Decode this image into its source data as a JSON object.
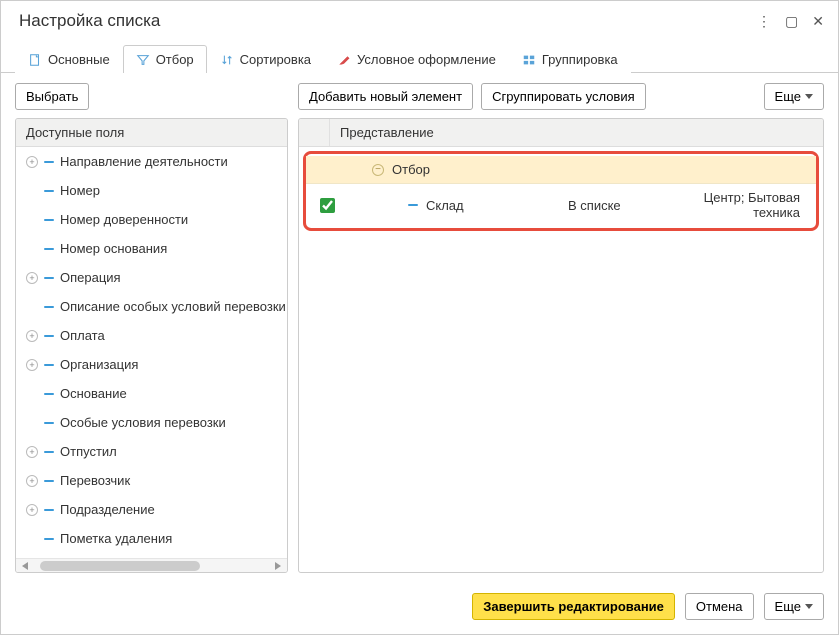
{
  "window": {
    "title": "Настройка списка"
  },
  "tabs": [
    {
      "label": "Основные"
    },
    {
      "label": "Отбор"
    },
    {
      "label": "Сортировка"
    },
    {
      "label": "Условное оформление"
    },
    {
      "label": "Группировка"
    }
  ],
  "toolbar": {
    "select_label": "Выбрать",
    "add_label": "Добавить новый элемент",
    "group_label": "Сгруппировать условия",
    "more_label": "Еще"
  },
  "left_panel": {
    "header": "Доступные поля",
    "fields": [
      {
        "label": "Направление деятельности",
        "expandable": true
      },
      {
        "label": "Номер",
        "expandable": false
      },
      {
        "label": "Номер доверенности",
        "expandable": false
      },
      {
        "label": "Номер основания",
        "expandable": false
      },
      {
        "label": "Операция",
        "expandable": true
      },
      {
        "label": "Описание особых условий перевозки",
        "expandable": false
      },
      {
        "label": "Оплата",
        "expandable": true
      },
      {
        "label": "Организация",
        "expandable": true
      },
      {
        "label": "Основание",
        "expandable": false
      },
      {
        "label": "Особые условия перевозки",
        "expandable": false
      },
      {
        "label": "Отпустил",
        "expandable": true
      },
      {
        "label": "Перевозчик",
        "expandable": true
      },
      {
        "label": "Подразделение",
        "expandable": true
      },
      {
        "label": "Пометка удаления",
        "expandable": false
      }
    ]
  },
  "right_panel": {
    "header": "Представление",
    "group_label": "Отбор",
    "condition": {
      "checked": true,
      "field": "Склад",
      "operator": "В списке",
      "value": "Центр; Бытовая техника"
    }
  },
  "footer": {
    "finish_label": "Завершить редактирование",
    "cancel_label": "Отмена",
    "more_label": "Еще"
  }
}
